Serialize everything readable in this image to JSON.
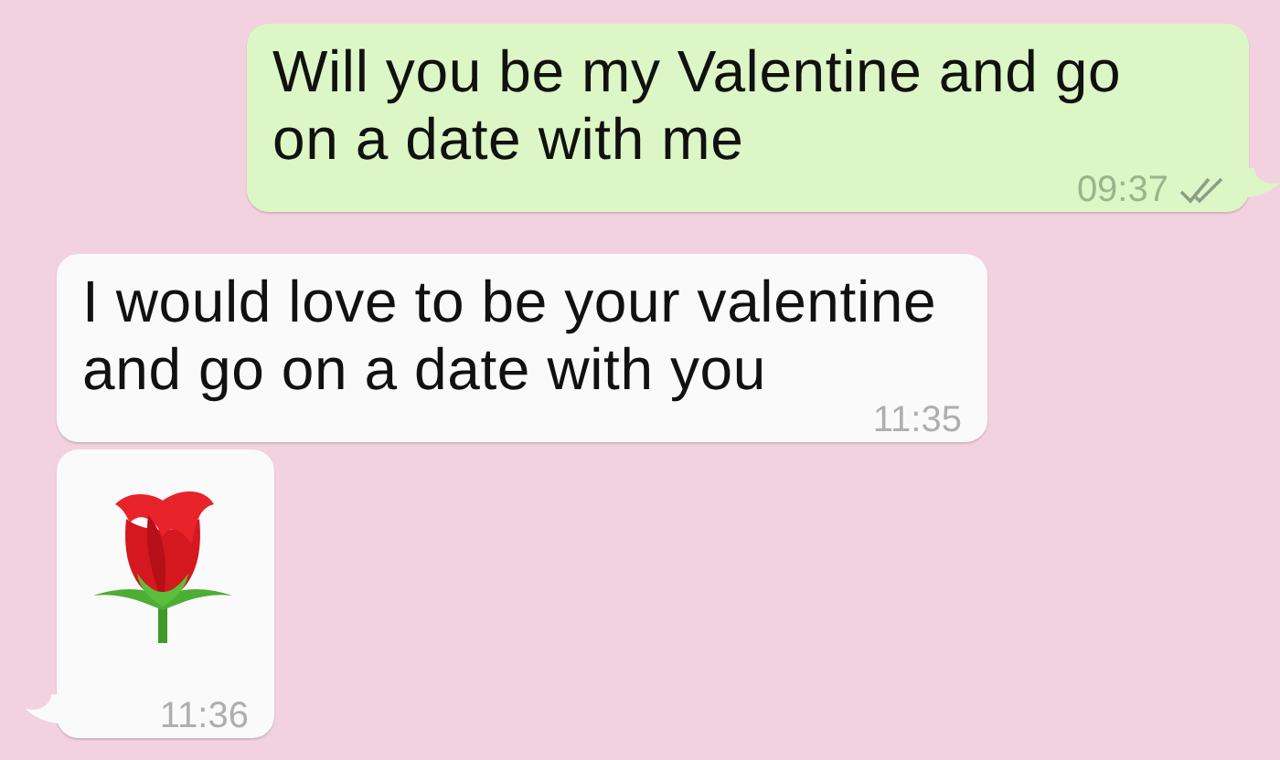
{
  "messages": [
    {
      "kind": "text",
      "outgoing": true,
      "text": "Will you be my Valentine and go on a date with me",
      "time": "09:37",
      "read": true,
      "tail": true
    },
    {
      "kind": "text",
      "outgoing": false,
      "text": "I would love to be your valentine and go on a date with you",
      "time": "11:35",
      "tail": false
    },
    {
      "kind": "sticker",
      "outgoing": false,
      "time": "11:36",
      "tail": true
    }
  ]
}
